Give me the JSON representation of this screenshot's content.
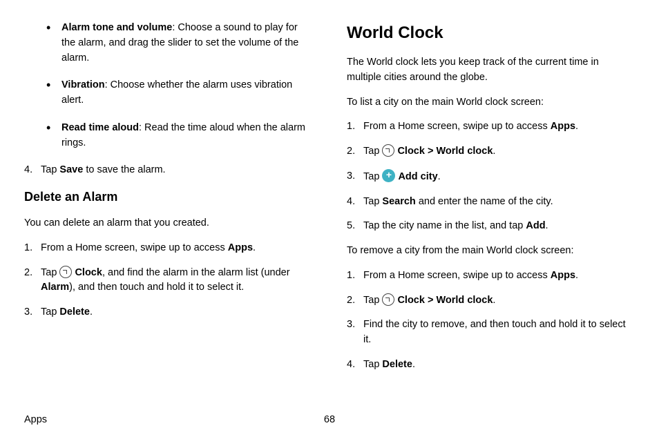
{
  "left": {
    "bullets": [
      {
        "title": "Alarm tone and volume",
        "desc": ": Choose a sound to play for the alarm, and drag the slider to set the volume of the alarm."
      },
      {
        "title": "Vibration",
        "desc": ": Choose whether the alarm uses vibration alert."
      },
      {
        "title": "Read time aloud",
        "desc": ": Read the time aloud when the alarm rings."
      }
    ],
    "step4_pre": "Tap ",
    "step4_bold": "Save",
    "step4_post": " to save the alarm.",
    "delete_heading": "Delete an Alarm",
    "delete_intro": "You can delete an alarm that you created.",
    "delete_steps": {
      "s1_pre": "From a Home screen, swipe up to access ",
      "s1_bold": "Apps",
      "s1_post": ".",
      "s2_pre": "Tap ",
      "s2_bold1": "Clock",
      "s2_mid": ", and find the alarm in the alarm list (under ",
      "s2_bold2": "Alarm",
      "s2_post": "), and then touch and hold it to select it.",
      "s3_pre": "Tap ",
      "s3_bold": "Delete",
      "s3_post": "."
    }
  },
  "right": {
    "heading": "World Clock",
    "intro1": "The World clock lets you keep track of the current time in multiple cities around the globe.",
    "intro2": "To list a city on the main World clock screen:",
    "add_steps": {
      "s1_pre": "From a Home screen, swipe up to access ",
      "s1_bold": "Apps",
      "s1_post": ".",
      "s2_pre": "Tap ",
      "s2_bold1": "Clock",
      "s2_sep": " > ",
      "s2_bold2": "World clock",
      "s2_post": ".",
      "s3_pre": "Tap ",
      "s3_bold": "Add city",
      "s3_post": ".",
      "s4_pre": "Tap ",
      "s4_bold": "Search",
      "s4_post": " and enter the name of the city.",
      "s5_pre": "Tap the city name in the list, and tap ",
      "s5_bold": "Add",
      "s5_post": "."
    },
    "intro3": "To remove a city from the main World clock screen:",
    "remove_steps": {
      "s1_pre": "From a Home screen, swipe up to access ",
      "s1_bold": "Apps",
      "s1_post": ".",
      "s2_pre": "Tap ",
      "s2_bold1": "Clock",
      "s2_sep": " > ",
      "s2_bold2": "World clock",
      "s2_post": ".",
      "s3": "Find the city to remove, and then touch and hold it to select it.",
      "s4_pre": "Tap ",
      "s4_bold": "Delete",
      "s4_post": "."
    }
  },
  "footer": {
    "section": "Apps",
    "page": "68"
  }
}
